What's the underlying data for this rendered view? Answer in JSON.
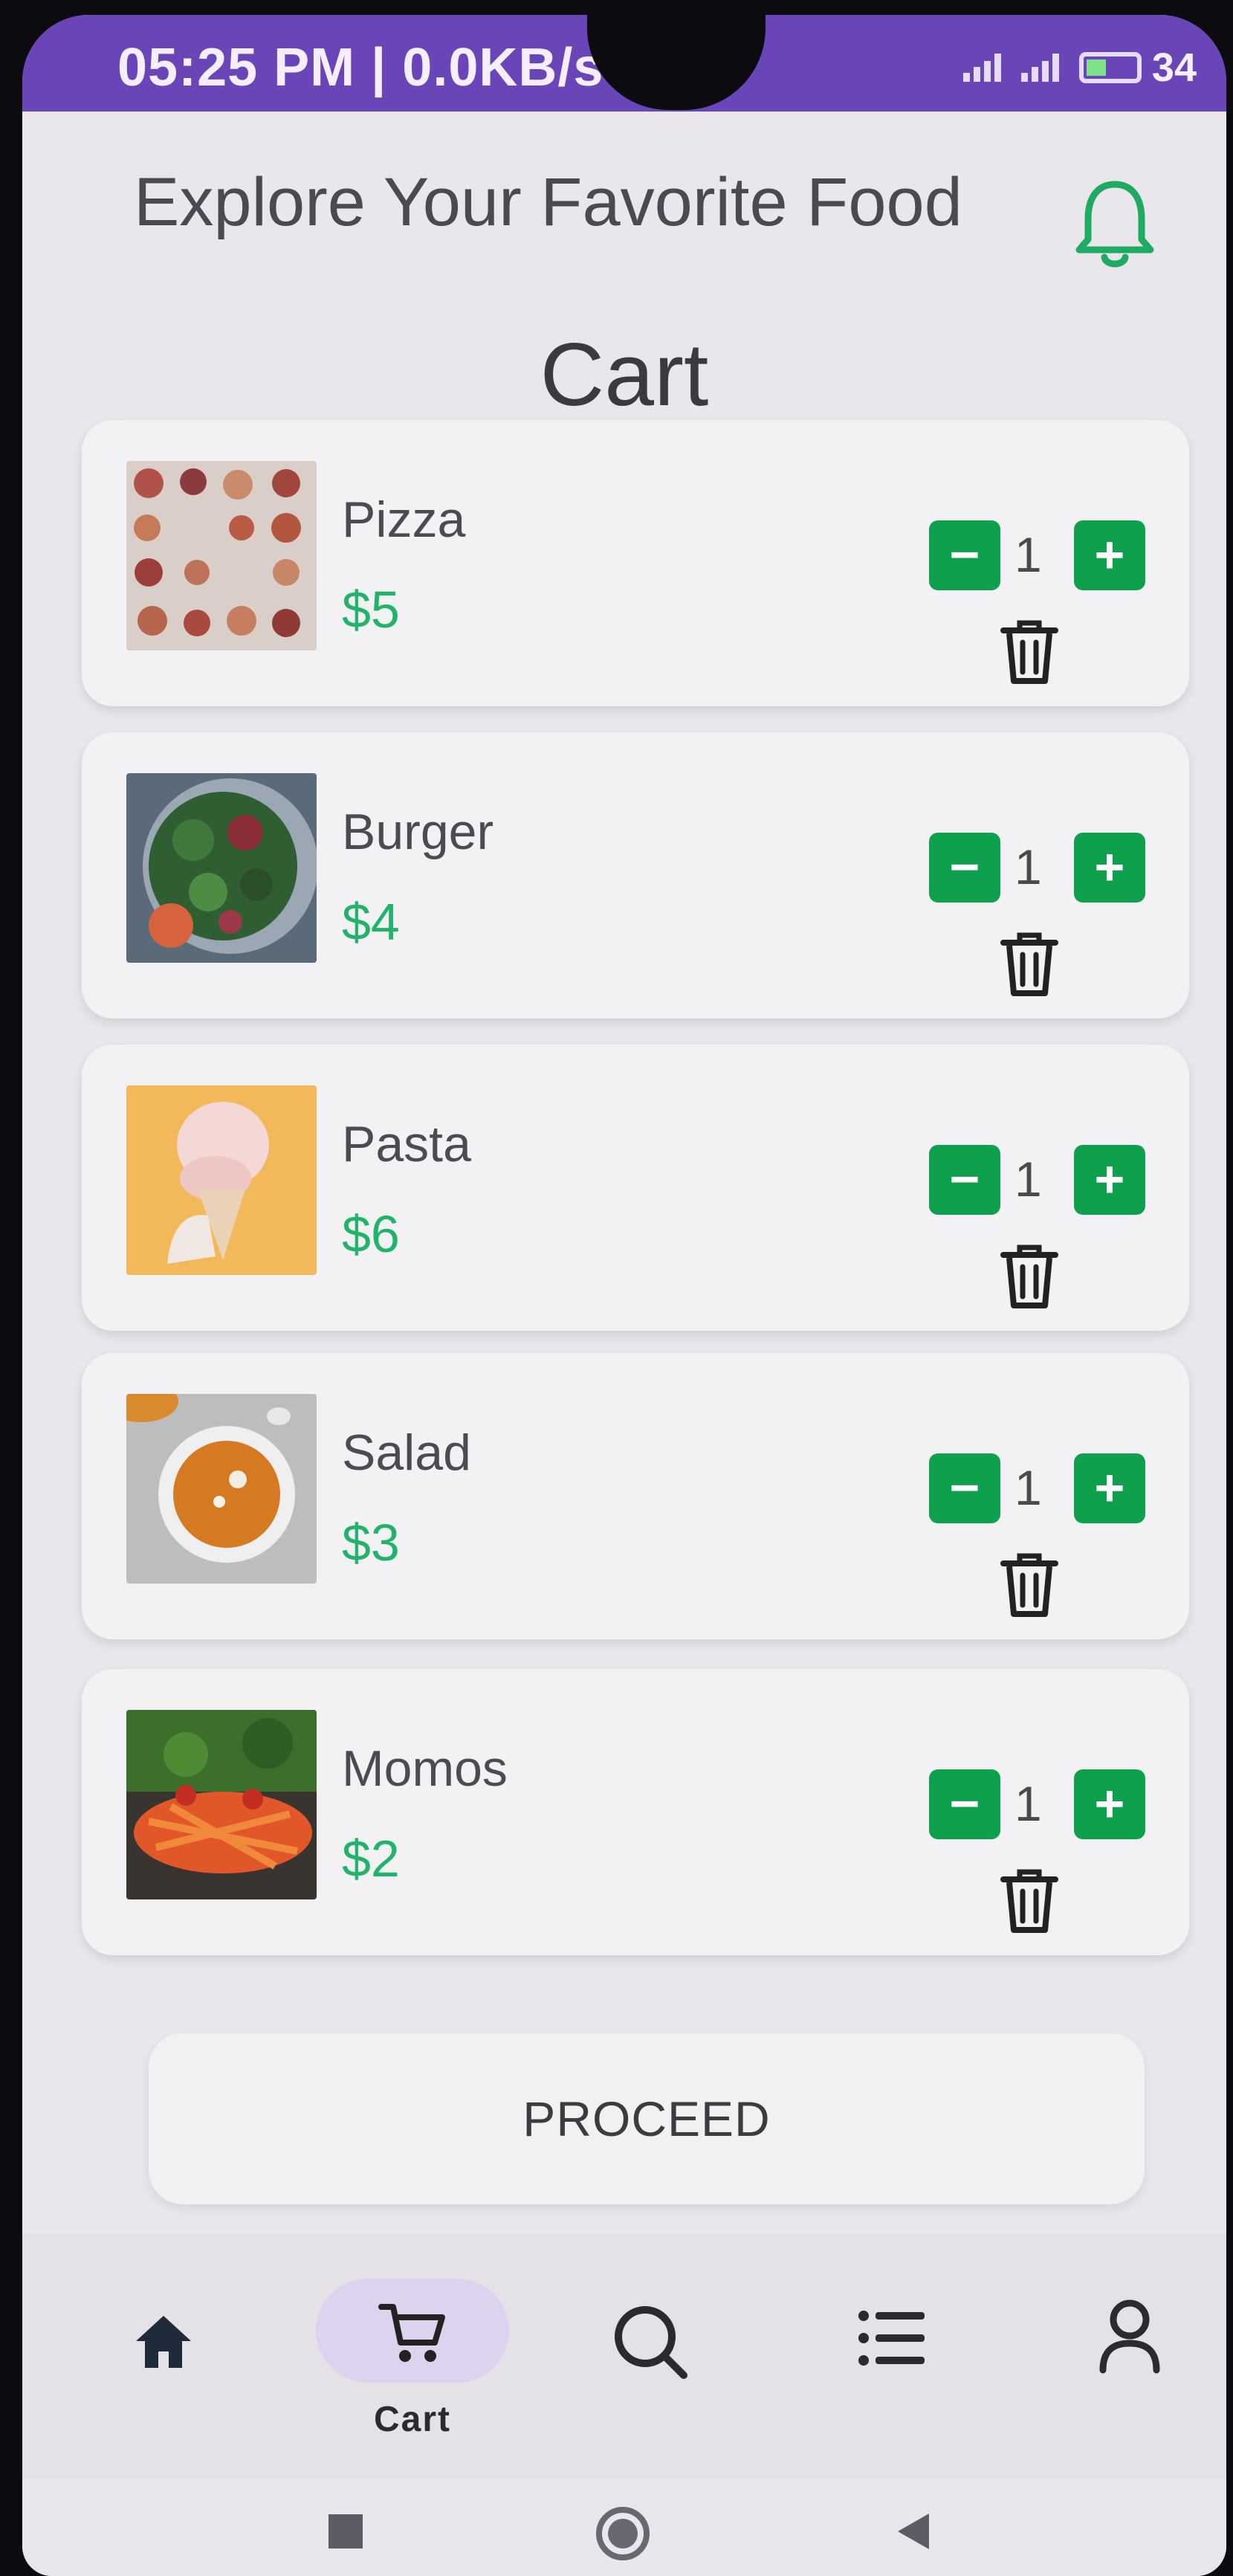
{
  "status_bar": {
    "time_speed": "05:25 PM | 0.0KB/s",
    "battery": "34"
  },
  "header": {
    "title": "Explore Your Favorite Food"
  },
  "page": {
    "title": "Cart"
  },
  "cart_items": [
    {
      "name": "Pizza",
      "price": "$5",
      "quantity": "1"
    },
    {
      "name": "Burger",
      "price": "$4",
      "quantity": "1"
    },
    {
      "name": "Pasta",
      "price": "$6",
      "quantity": "1"
    },
    {
      "name": "Salad",
      "price": "$3",
      "quantity": "1"
    },
    {
      "name": "Momos",
      "price": "$2",
      "quantity": "1"
    }
  ],
  "controls": {
    "minus": "−",
    "plus": "+"
  },
  "proceed_label": "PROCEED",
  "bottom_nav": {
    "items": [
      "home-icon",
      "cart-icon",
      "search-icon",
      "list-icon",
      "profile-icon"
    ],
    "active_label": "Cart"
  },
  "colors": {
    "accent_green": "#0fa04e",
    "price_green": "#22b36b",
    "status_purple": "#6a45b8"
  }
}
